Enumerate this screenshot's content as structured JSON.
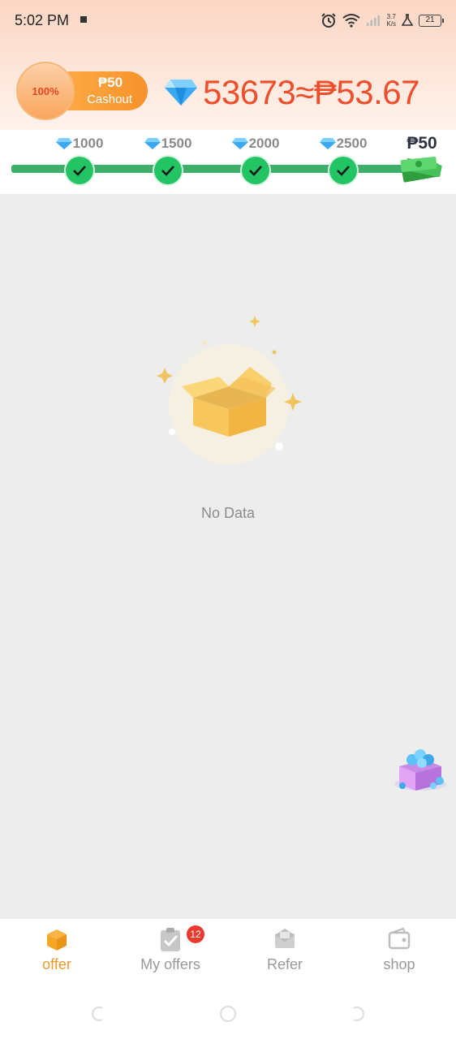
{
  "status_bar": {
    "time": "5:02 PM",
    "net_speed": "3.7",
    "net_unit": "K/s",
    "battery": "21"
  },
  "header": {
    "cashout_percent": "100%",
    "cashout_amount": "₱50",
    "cashout_label": "Cashout",
    "balance_text": "53673≈₱53.67"
  },
  "milestones": [
    {
      "label": "1000",
      "done": true
    },
    {
      "label": "1500",
      "done": true
    },
    {
      "label": "2000",
      "done": true
    },
    {
      "label": "2500",
      "done": true
    }
  ],
  "final_reward": "₱50",
  "empty_state": {
    "message": "No Data"
  },
  "tabs": [
    {
      "label": "offer",
      "icon": "box-icon",
      "active": true
    },
    {
      "label": "My offers",
      "icon": "clipboard-check-icon",
      "active": false,
      "badge": "12"
    },
    {
      "label": "Refer",
      "icon": "envelope-icon",
      "active": false
    },
    {
      "label": "shop",
      "icon": "wallet-icon",
      "active": false
    }
  ],
  "colors": {
    "accent": "#f0992a",
    "balance": "#ed4f2d",
    "progress": "#3fae6a",
    "check": "#22c464",
    "badge": "#ec3b2e"
  }
}
